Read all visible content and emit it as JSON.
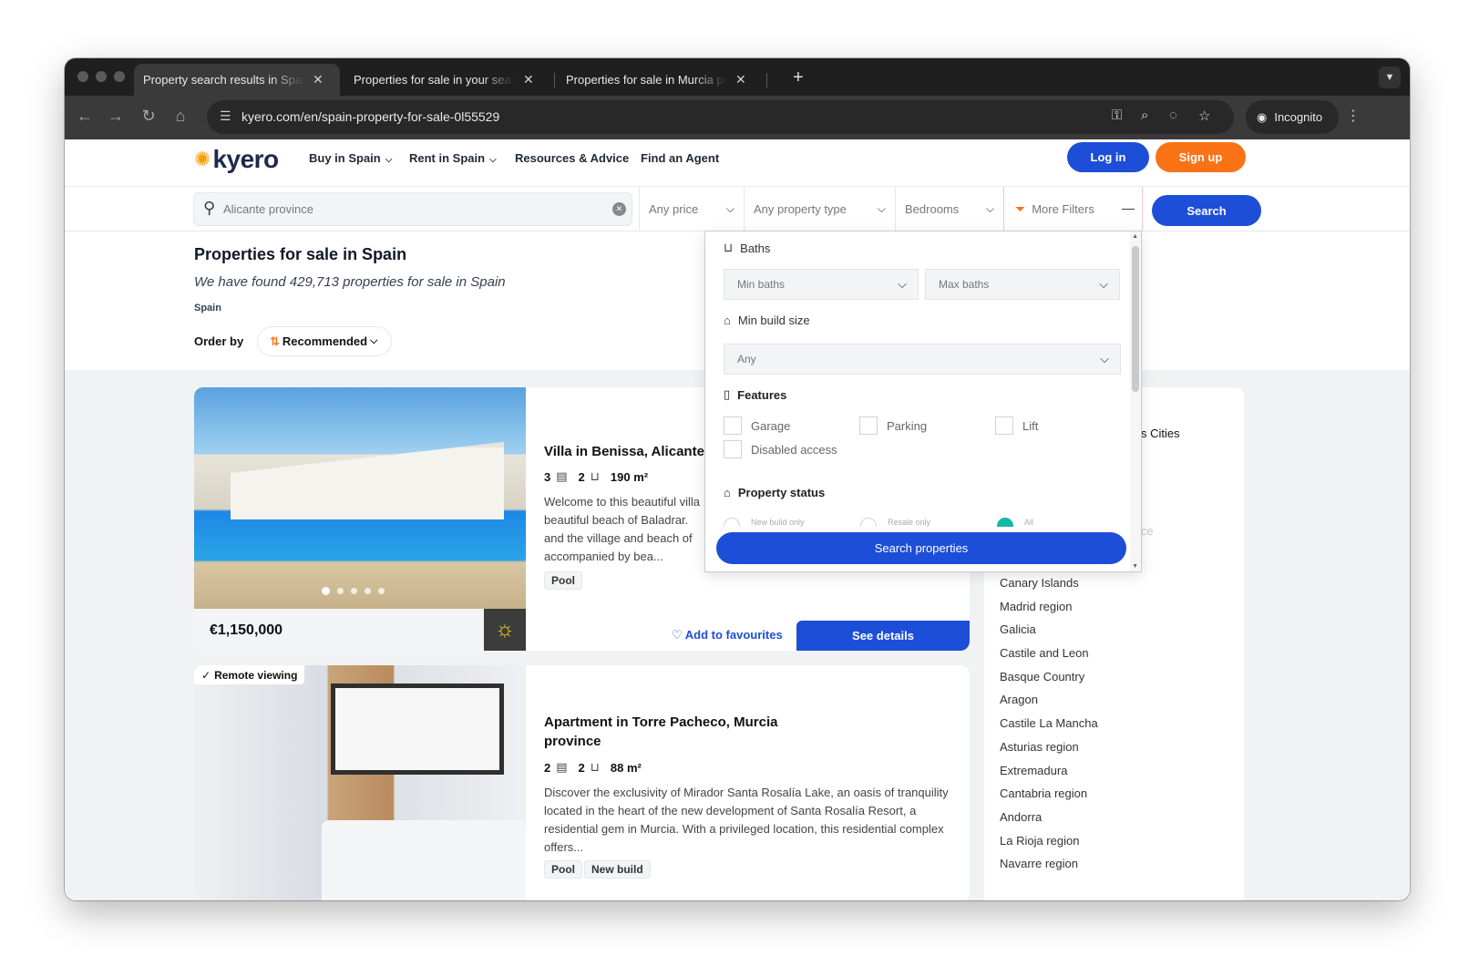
{
  "browser": {
    "tabs": [
      {
        "title": "Property search results in Spain",
        "active": true
      },
      {
        "title": "Properties for sale in your search",
        "active": false
      },
      {
        "title": "Properties for sale in Murcia province",
        "active": false
      }
    ],
    "new_tab": "+",
    "url": "kyero.com/en/spain-property-for-sale-0l55529",
    "incognito_label": "Incognito"
  },
  "site": {
    "logo_text": "kyero",
    "menu": [
      {
        "label": "Buy in Spain",
        "has_dropdown": true
      },
      {
        "label": "Rent in Spain",
        "has_dropdown": true
      },
      {
        "label": "Resources & Advice",
        "has_dropdown": false
      },
      {
        "label": "Find an Agent",
        "has_dropdown": false
      }
    ],
    "login_label": "Log in",
    "signup_label": "Sign up"
  },
  "search": {
    "location_placeholder": "Alicante province",
    "price_label": "Any price",
    "type_label": "Any property type",
    "bedrooms_label": "Bedrooms",
    "more_filters_label": "More Filters",
    "search_label": "Search"
  },
  "results": {
    "title": "Properties for sale in Spain",
    "count_text": "We have found 429,713 properties for sale in Spain",
    "breadcrumb": "Spain",
    "order_label": "Order by",
    "order_value": "Recommended"
  },
  "filters_popup": {
    "baths_label": "Baths",
    "min_baths": "Min baths",
    "max_baths": "Max baths",
    "build_size_label": "Min build size",
    "build_size_value": "Any",
    "features_label": "Features",
    "features": [
      "Garage",
      "Parking",
      "Lift",
      "Disabled access"
    ],
    "status_label": "Property status",
    "status_options": [
      "New build only",
      "Resale only",
      "All"
    ],
    "status_selected": "All",
    "search_button": "Search properties"
  },
  "listings": [
    {
      "title": "Villa in Benissa, Alicante",
      "beds": "3",
      "baths": "2",
      "size": "190 m²",
      "description_lines": [
        "Welcome to this beautiful villa",
        "beautiful beach of Baladrar.",
        "and the village and beach of",
        "accompanied by bea..."
      ],
      "tags": [
        "Pool"
      ],
      "price": "€1,150,000",
      "favourite_label": "Add to favourites",
      "details_label": "See details"
    },
    {
      "badge": "Remote viewing",
      "title": "Apartment in Torre Pacheco, Murcia province",
      "beds": "2",
      "baths": "2",
      "size": "88 m²",
      "description": "Discover the exclusivity of Mirador Santa Rosalía Lake, an oasis of tranquility located in the heart of the new development of Santa Rosalía Resort, a residential gem in Murcia. With a privileged location, this residential complex offers...",
      "tags": [
        "Pool",
        "New build"
      ]
    }
  ],
  "sidebar": {
    "cities_fragment": "s  Cities",
    "faded_fragment": "ce",
    "regions": [
      "Canary Islands",
      "Madrid region",
      "Galicia",
      "Castile and Leon",
      "Basque Country",
      "Aragon",
      "Castile La Mancha",
      "Asturias region",
      "Extremadura",
      "Cantabria region",
      "Andorra",
      "La Rioja region",
      "Navarre region"
    ]
  },
  "colors": {
    "brand_blue": "#1d4ed8",
    "brand_orange": "#f97316",
    "radio_selected": "#14b8a6"
  }
}
